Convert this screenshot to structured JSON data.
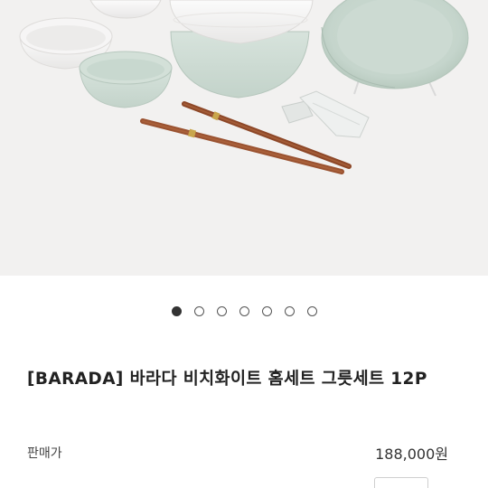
{
  "product": {
    "title": "[BARADA] 바라다 비치화이트 홈세트 그릇세트 12P",
    "image_alt": "BARADA beach white home tableware set"
  },
  "gallery": {
    "total_slides": 7,
    "active_index": 0
  },
  "price": {
    "label": "판매가",
    "value": "188,000원"
  },
  "colors": {
    "hero_bg": "#f2f1f0",
    "white_ware": "#f4f3f3",
    "sage_ware": "#cfdcd5",
    "chopsticks": "#9a5230"
  }
}
